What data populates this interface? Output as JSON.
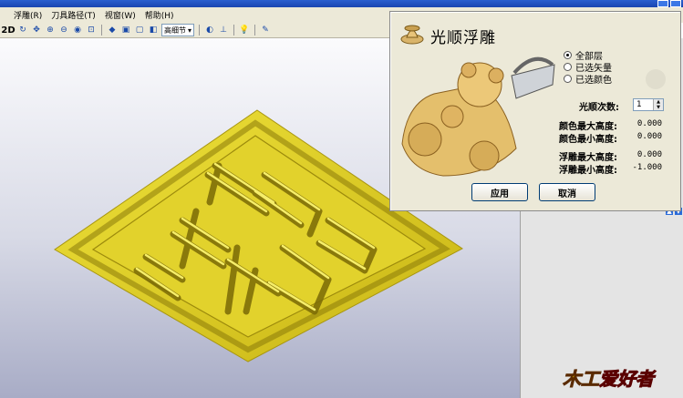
{
  "menu": {
    "items": [
      "浮雕(R)",
      "刀具路径(T)",
      "视窗(W)",
      "帮助(H)"
    ]
  },
  "toolbar": {
    "mode_2d": "2D",
    "detail_select": "高细节"
  },
  "dialog": {
    "title": "光顺浮雕",
    "scope_options": [
      {
        "label": "全部层",
        "selected": true
      },
      {
        "label": "已选矢量",
        "selected": false
      },
      {
        "label": "已选颜色",
        "selected": false
      }
    ],
    "smooth_count_label": "光顺次数:",
    "smooth_count_value": "1",
    "color_max_label": "颜色最大高度:",
    "color_max_value": "0.000",
    "color_min_label": "颜色最小高度:",
    "color_min_value": "0.000",
    "relief_max_label": "浮雕最大高度:",
    "relief_max_value": "0.000",
    "relief_min_label": "浮雕最小高度:",
    "relief_min_value": "-1.000",
    "apply_label": "应用",
    "cancel_label": "取消"
  },
  "brand": {
    "part1": "木工",
    "part2": "爱好者"
  },
  "colors": {
    "relief_gold": "#d4c21e",
    "relief_dark": "#8a7a0a",
    "dialog_bg": "#ece9d8",
    "panel_bg": "#e4e4e4"
  },
  "icons": {
    "title_icon": "relief-3d-icon",
    "preview_image": "bear-teddy-iron-preview"
  }
}
